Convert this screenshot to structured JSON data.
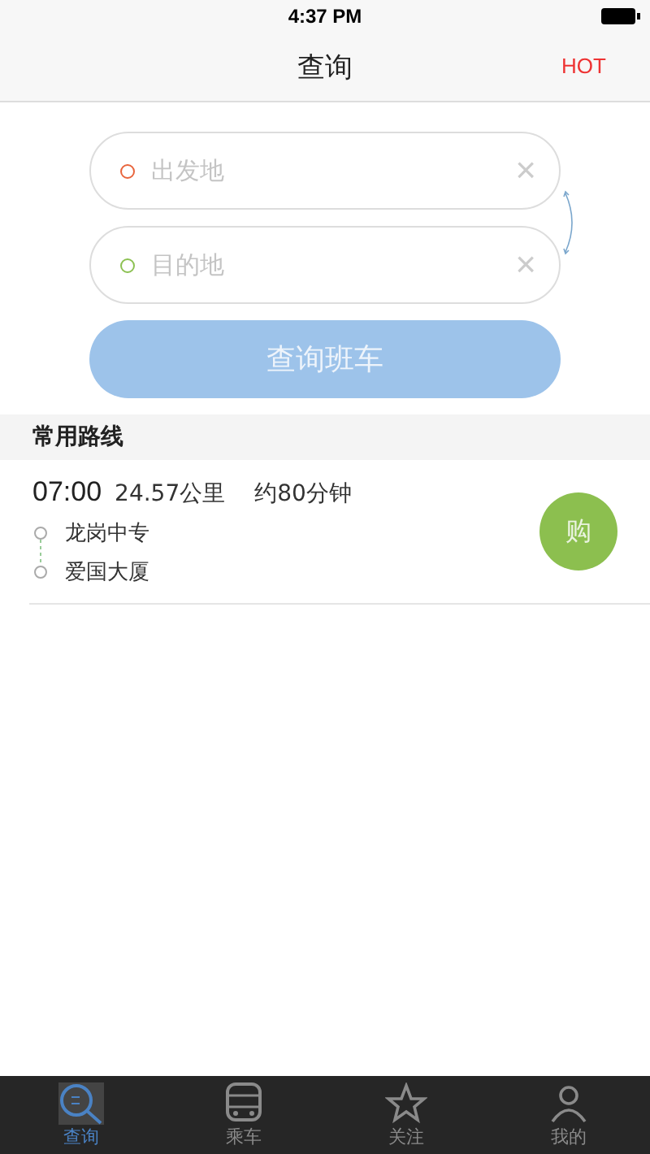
{
  "status_bar": {
    "time": "4:37 PM"
  },
  "nav": {
    "title": "查询",
    "action": "HOT"
  },
  "search": {
    "from": {
      "placeholder": "出发地",
      "color": "#e8643c"
    },
    "to": {
      "placeholder": "目的地",
      "color": "#8cc152"
    },
    "clear": "×",
    "button": "查询班车"
  },
  "section_title": "常用路线",
  "routes": [
    {
      "time": "07:00",
      "distance": "24.57公里",
      "duration": "约80分钟",
      "stops": [
        "龙岗中专",
        "爱国大厦"
      ],
      "buy": "购"
    }
  ],
  "tabs": [
    {
      "label": "查询",
      "kind": "search",
      "selected": true
    },
    {
      "label": "乘车",
      "kind": "bus",
      "selected": false
    },
    {
      "label": "关注",
      "kind": "star",
      "selected": false
    },
    {
      "label": "我的",
      "kind": "person",
      "selected": false
    }
  ]
}
